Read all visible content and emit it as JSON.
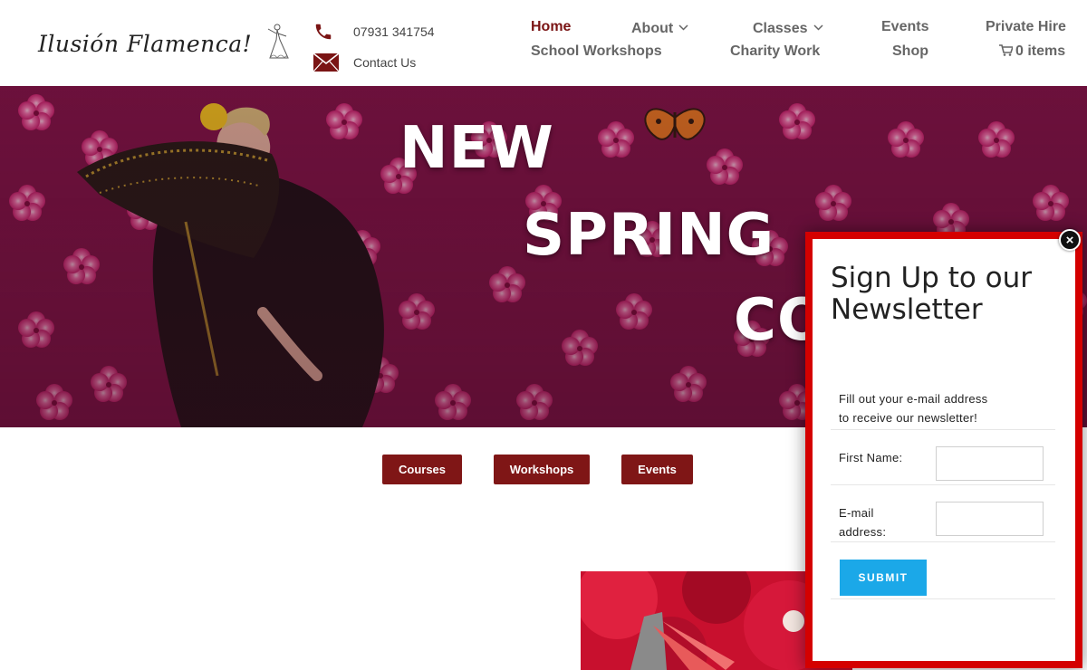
{
  "site": {
    "logo_text": "Ilusión Flamenca!",
    "logo_icon": "flamenco-dancer-sketch"
  },
  "contact": {
    "phone": "07931 341754",
    "contact_label": "Contact Us",
    "icons": [
      "phone-icon",
      "envelope-icon"
    ]
  },
  "nav": {
    "items": [
      {
        "label": "Home",
        "active": true,
        "dropdown": false
      },
      {
        "label": "About",
        "active": false,
        "dropdown": true
      },
      {
        "label": "Classes",
        "active": false,
        "dropdown": true
      },
      {
        "label": "Events",
        "active": false,
        "dropdown": false
      },
      {
        "label": "Private Hire",
        "active": false,
        "dropdown": false
      },
      {
        "label": "School Workshops",
        "active": false,
        "dropdown": false
      },
      {
        "label": "Charity Work",
        "active": false,
        "dropdown": false
      },
      {
        "label": "Shop",
        "active": false,
        "dropdown": false
      },
      {
        "label": "0 items",
        "active": false,
        "dropdown": false,
        "icon": "cart-icon"
      }
    ]
  },
  "hero": {
    "words": [
      "NEW",
      "SPRING",
      "CO"
    ]
  },
  "cta_buttons": [
    {
      "label": "Courses"
    },
    {
      "label": "Workshops"
    },
    {
      "label": "Events"
    }
  ],
  "popup": {
    "title": "Sign Up to our Newsletter",
    "description_line1": "Fill out your e-mail address",
    "description_line2": "to receive our newsletter!",
    "first_name_label": "First Name:",
    "email_label_line1": "E-mail",
    "email_label_line2": "address:",
    "first_name_value": "",
    "email_value": "",
    "submit_label": "SUBMIT",
    "close_glyph": "×"
  },
  "colors": {
    "brand_red": "#7a1414",
    "button_red": "#7f1616",
    "popup_border": "#d40000",
    "submit_blue": "#1ba8e8",
    "hero_pink": "#b0175c"
  }
}
